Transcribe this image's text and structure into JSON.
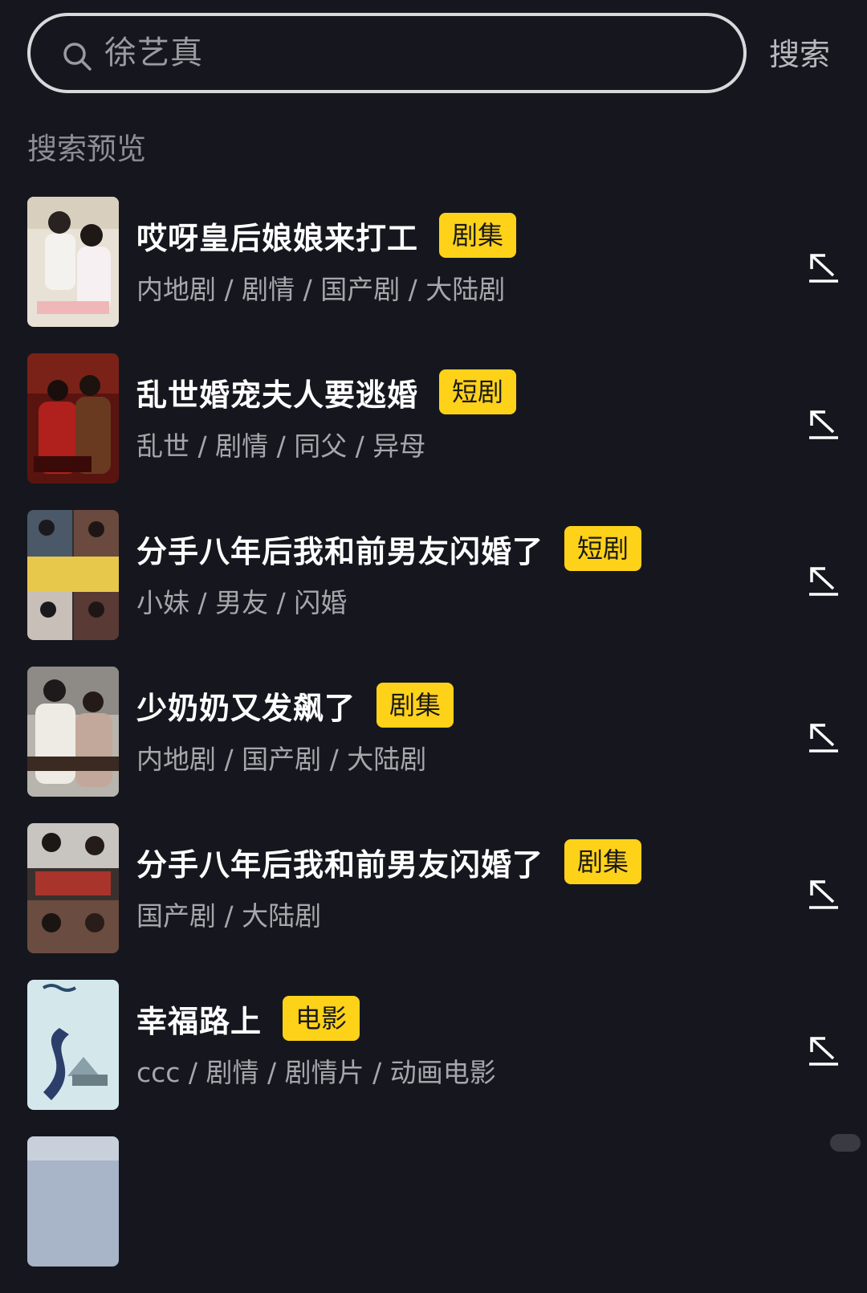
{
  "search": {
    "query": "徐艺真",
    "button_label": "搜索"
  },
  "section_title": "搜索预览",
  "results": [
    {
      "title": "哎呀皇后娘娘来打工",
      "badge": "剧集",
      "tags": "内地剧 / 剧情 / 国产剧 / 大陆剧"
    },
    {
      "title": "乱世婚宠夫人要逃婚",
      "badge": "短剧",
      "tags": "乱世 / 剧情 / 同父 / 异母"
    },
    {
      "title": "分手八年后我和前男友闪婚了",
      "badge": "短剧",
      "tags": "小妹 / 男友 / 闪婚"
    },
    {
      "title": "少奶奶又发飙了",
      "badge": "剧集",
      "tags": "内地剧 / 国产剧 / 大陆剧"
    },
    {
      "title": "分手八年后我和前男友闪婚了",
      "badge": "剧集",
      "tags": "国产剧 / 大陆剧"
    },
    {
      "title": "幸福路上",
      "badge": "电影",
      "tags": "ccc / 剧情 / 剧情片 / 动画电影"
    }
  ],
  "colors": {
    "background": "#16171e",
    "badge": "#ffd21a",
    "title": "#ffffff",
    "tags": "#a6a7ab"
  },
  "icons": {
    "search": "search-icon",
    "open": "arrow-up-left-icon"
  }
}
